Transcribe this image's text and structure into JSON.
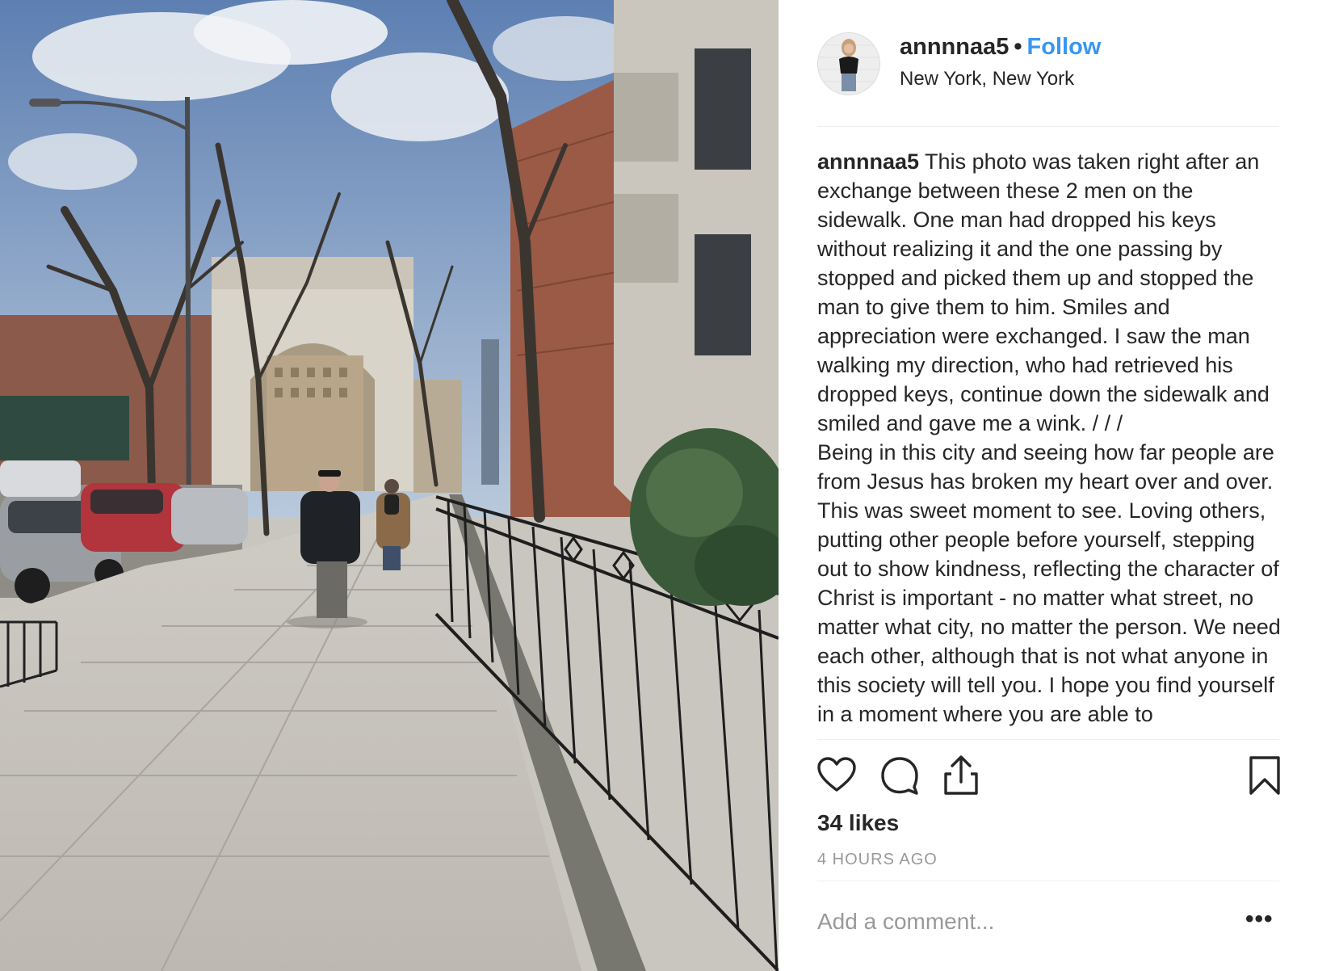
{
  "post": {
    "username": "annnnaa5",
    "separator": "•",
    "follow_label": "Follow",
    "location": "New York, New York",
    "caption_user": "annnnaa5",
    "caption_text": " This photo was taken right after an exchange between these 2 men on the sidewalk. One man had dropped his keys without realizing it and the one passing by stopped and picked them up and stopped the man to give them to him. Smiles and appreciation were exchanged. I saw the man walking my direction, who had retrieved his dropped keys, continue down the sidewalk and smiled and gave me a wink. / / /\nBeing in this city and seeing how far people are from Jesus has broken my heart over and over. This was sweet moment to see. Loving others, putting other people before yourself, stepping out to show kindness, reflecting the character of Christ is important - no matter what street, no matter what city, no matter the person. We need each other, although that is not what anyone in this society will tell you. I hope you find yourself in a moment where you are able to",
    "likes": "34 likes",
    "time_ago": "4 HOURS AGO",
    "comment_placeholder": "Add a comment...",
    "more_label": "•••"
  },
  "icons": {
    "like": "heart-icon",
    "comment": "speech-bubble-icon",
    "share": "share-icon",
    "save": "bookmark-icon",
    "more": "more-options-icon"
  },
  "colors": {
    "follow": "#3897f0",
    "text": "#262626",
    "muted": "#999999",
    "divider": "#efefef"
  }
}
